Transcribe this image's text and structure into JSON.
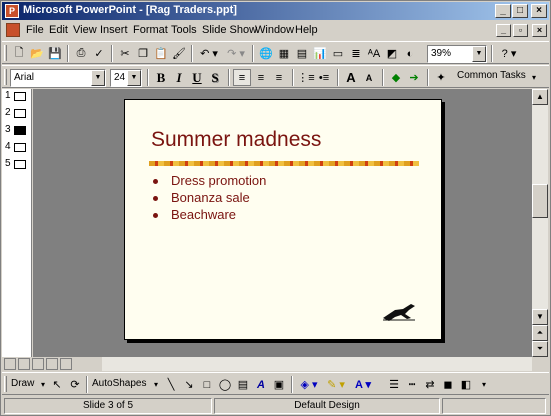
{
  "window": {
    "title": "Microsoft PowerPoint - [Rag Traders.ppt]"
  },
  "menu": [
    "File",
    "Edit",
    "View",
    "Insert",
    "Format",
    "Tools",
    "Slide Show",
    "Window",
    "Help"
  ],
  "standard_toolbar": {
    "zoom": "39%"
  },
  "formatting_toolbar": {
    "font": "Arial",
    "size": "24",
    "common_tasks": "Common Tasks"
  },
  "outline": {
    "slides": [
      "1",
      "2",
      "3",
      "4",
      "5"
    ]
  },
  "slide": {
    "title": "Summer madness",
    "bullets": [
      "Dress promotion",
      "Bonanza sale",
      "Beachware"
    ]
  },
  "drawing_toolbar": {
    "draw": "Draw",
    "autoshapes": "AutoShapes"
  },
  "status": {
    "slide": "Slide 3 of 5",
    "design": "Default Design"
  },
  "colors": {
    "title_bar_start": "#0a246a",
    "title_bar_end": "#a6caf0",
    "slide_text": "#7a1410"
  }
}
